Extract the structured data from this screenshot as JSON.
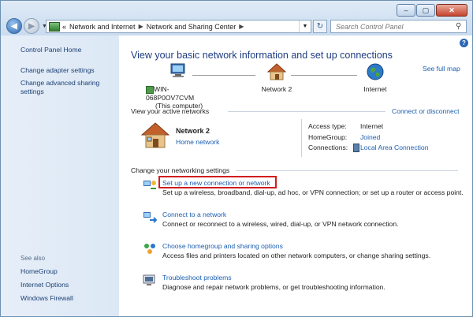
{
  "window": {
    "controls": [
      "–",
      "▢",
      "✕"
    ]
  },
  "address_bar": {
    "prefix": "«",
    "crumbs": [
      "Network and Internet",
      "Network and Sharing Center"
    ],
    "search_placeholder": "Search Control Panel"
  },
  "sidebar": {
    "home": "Control Panel Home",
    "links": [
      "Change adapter settings",
      "Change advanced sharing settings"
    ],
    "see_also_heading": "See also",
    "see_also": [
      "HomeGroup",
      "Internet Options",
      "Windows Firewall"
    ]
  },
  "main": {
    "heading": "View your basic network information and set up connections",
    "see_full_map": "See full map",
    "map": {
      "computer_name": "WIN-068P0OV7CVM",
      "computer_sub": "(This computer)",
      "network": "Network  2",
      "internet": "Internet"
    },
    "active_networks_label": "View your active networks",
    "connect_or_disconnect": "Connect or disconnect",
    "network": {
      "name": "Network  2",
      "type": "Home network",
      "access_type_label": "Access type:",
      "access_type_value": "Internet",
      "homegroup_label": "HomeGroup:",
      "homegroup_value": "Joined",
      "connections_label": "Connections:",
      "connections_value": "Local Area Connection"
    },
    "change_settings_label": "Change your networking settings",
    "tasks": [
      {
        "title": "Set up a new connection or network",
        "desc": "Set up a wireless, broadband, dial-up, ad hoc, or VPN connection; or set up a router or access point."
      },
      {
        "title": "Connect to a network",
        "desc": "Connect or reconnect to a wireless, wired, dial-up, or VPN network connection."
      },
      {
        "title": "Choose homegroup and sharing options",
        "desc": "Access files and printers located on other network computers, or change sharing settings."
      },
      {
        "title": "Troubleshoot problems",
        "desc": "Diagnose and repair network problems, or get troubleshooting information."
      }
    ]
  }
}
